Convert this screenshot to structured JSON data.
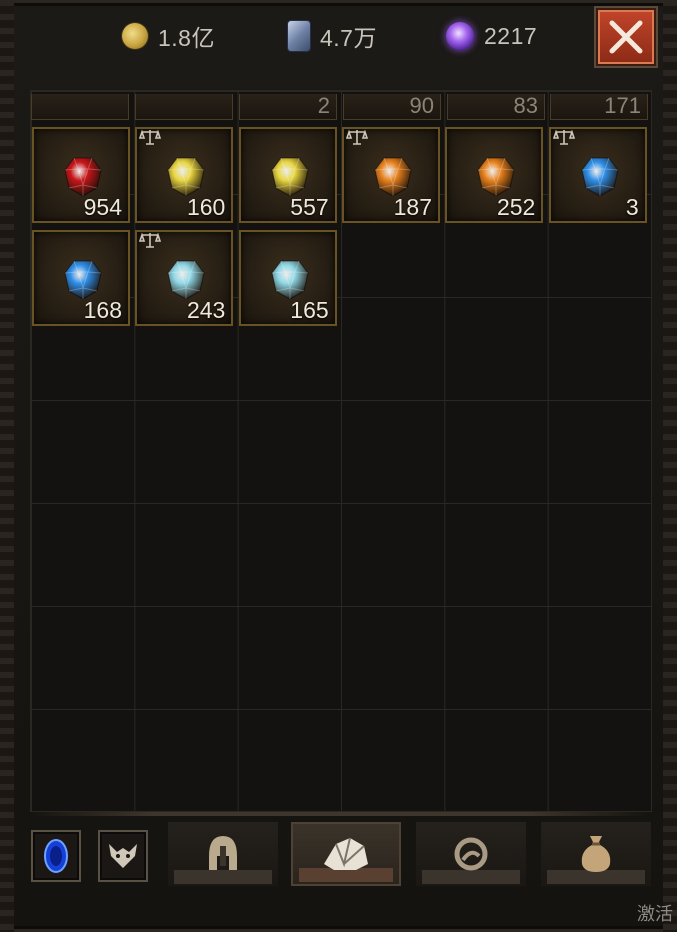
{
  "currencies": [
    {
      "icon": "gold-coin-icon",
      "value": "1.8亿"
    },
    {
      "icon": "obol-card-icon",
      "value": "4.7万"
    },
    {
      "icon": "purple-orb-icon",
      "value": "2217"
    }
  ],
  "top_row_counts": [
    "",
    "",
    "2",
    "90",
    "83",
    "171"
  ],
  "gems": [
    {
      "icon": "red-gem-icon",
      "color": "#c8161a",
      "count": "954",
      "tradeable": false
    },
    {
      "icon": "yellow-gem-icon",
      "color": "#e8d640",
      "count": "160",
      "tradeable": true
    },
    {
      "icon": "yellow-gem-icon",
      "color": "#e8d640",
      "count": "557",
      "tradeable": false
    },
    {
      "icon": "orange-gem-icon",
      "color": "#e8821e",
      "count": "187",
      "tradeable": true
    },
    {
      "icon": "orange-gem-icon",
      "color": "#e8821e",
      "count": "252",
      "tradeable": false
    },
    {
      "icon": "blue-gem-icon",
      "color": "#2f8fe8",
      "count": "3",
      "tradeable": true
    },
    {
      "icon": "blue-gem-icon",
      "color": "#2f8fe8",
      "count": "168",
      "tradeable": false
    },
    {
      "icon": "cyan-gem-icon",
      "color": "#8fd8e6",
      "count": "243",
      "tradeable": true
    },
    {
      "icon": "cyan-gem-icon",
      "color": "#8fd8e6",
      "count": "165",
      "tradeable": false
    }
  ],
  "bottom": {
    "small_buttons": [
      "blue-portal-icon",
      "demon-emblem-icon"
    ],
    "tabs": [
      "helmet-icon",
      "gem-pouch-icon",
      "skull-rune-icon",
      "sack-icon"
    ],
    "active_tab": 1
  },
  "watermark": "激活"
}
